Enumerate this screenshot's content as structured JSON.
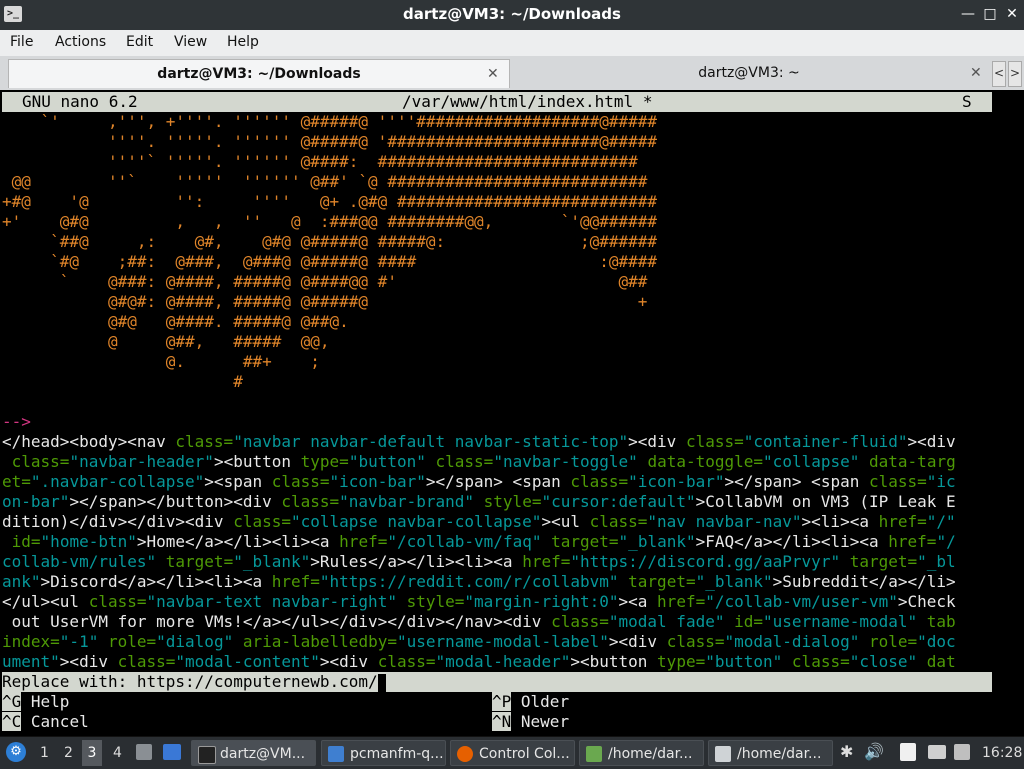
{
  "window": {
    "title": "dartz@VM3: ~/Downloads",
    "minimize": "—",
    "maximize": "□",
    "close": "✕"
  },
  "menu": [
    "File",
    "Actions",
    "Edit",
    "View",
    "Help"
  ],
  "tabs": [
    {
      "label": "dartz@VM3: ~/Downloads",
      "active": true
    },
    {
      "label": "dartz@VM3: ~",
      "active": false
    }
  ],
  "tab_nav": {
    "prev": "<",
    "next": ">"
  },
  "nano": {
    "version": "GNU nano 6.2",
    "file": "/var/www/html/index.html *",
    "flag": "S"
  },
  "ascii_lines": [
    "    `'     ,''', +''''. '''''' @#####@ ''''###################@#####",
    "           ''''. '''''. '''''' @#####@ '######################@#####",
    "           ''''` '''''. '''''' @####:  ###########################",
    " @@        ''`    '''''  '''''' @##' `@ ###########################",
    "+#@    '@         '':     ''''   @+ .@#@ ###########################",
    "+'    @#@         ,   ,  ''   @  :###@@ ########@@,       `'@@######",
    "     `##@     ,:    @#,    @#@ @#####@ #####@:              ;@######",
    "     `#@    ;##:  @###,  @###@ @#####@ ####                   :@####",
    "      `    @###: @####, #####@ @####@@ #'                       @##",
    "           @#@#: @####, #####@ @#####@                            +",
    "           @#@   @####. #####@ @##@.",
    "           @     @##,   #####  @@,",
    "                 @.      ##+    ;",
    "                        #"
  ],
  "comment_end": "-->",
  "code_lines": [
    [
      [
        "w",
        "</head><body><nav "
      ],
      [
        "g",
        "class="
      ],
      [
        "c",
        "\"navbar navbar-default navbar-static-top\""
      ],
      [
        "w",
        "><div "
      ],
      [
        "g",
        "class="
      ],
      [
        "c",
        "\"container-fluid\""
      ],
      [
        "w",
        "><div"
      ]
    ],
    [
      [
        "w",
        " "
      ],
      [
        "g",
        "class="
      ],
      [
        "c",
        "\"navbar-header\""
      ],
      [
        "w",
        "><button "
      ],
      [
        "g",
        "type="
      ],
      [
        "c",
        "\"button\""
      ],
      [
        "w",
        " "
      ],
      [
        "g",
        "class="
      ],
      [
        "c",
        "\"navbar-toggle\""
      ],
      [
        "w",
        " "
      ],
      [
        "g",
        "data-toggle="
      ],
      [
        "c",
        "\"collapse\""
      ],
      [
        "w",
        " "
      ],
      [
        "g",
        "data-targ"
      ]
    ],
    [
      [
        "g",
        "et="
      ],
      [
        "c",
        "\".navbar-collapse\""
      ],
      [
        "w",
        "><span "
      ],
      [
        "g",
        "class="
      ],
      [
        "c",
        "\"icon-bar\""
      ],
      [
        "w",
        "></span> <span "
      ],
      [
        "g",
        "class="
      ],
      [
        "c",
        "\"icon-bar\""
      ],
      [
        "w",
        "></span> <span "
      ],
      [
        "g",
        "class="
      ],
      [
        "c",
        "\"ic"
      ]
    ],
    [
      [
        "c",
        "on-bar\""
      ],
      [
        "w",
        "></span></button><div "
      ],
      [
        "g",
        "class="
      ],
      [
        "c",
        "\"navbar-brand\""
      ],
      [
        "w",
        " "
      ],
      [
        "g",
        "style="
      ],
      [
        "c",
        "\"cursor:default\""
      ],
      [
        "w",
        ">CollabVM on VM3 (IP Leak E"
      ]
    ],
    [
      [
        "w",
        "dition)</div></div><div "
      ],
      [
        "g",
        "class="
      ],
      [
        "c",
        "\"collapse navbar-collapse\""
      ],
      [
        "w",
        "><ul "
      ],
      [
        "g",
        "class="
      ],
      [
        "c",
        "\"nav navbar-nav\""
      ],
      [
        "w",
        "><li><a "
      ],
      [
        "g",
        "href="
      ],
      [
        "c",
        "\"/\""
      ]
    ],
    [
      [
        "w",
        " "
      ],
      [
        "g",
        "id="
      ],
      [
        "c",
        "\"home-btn\""
      ],
      [
        "w",
        ">Home</a></li><li><a "
      ],
      [
        "g",
        "href="
      ],
      [
        "c",
        "\"/collab-vm/faq\""
      ],
      [
        "w",
        " "
      ],
      [
        "g",
        "target="
      ],
      [
        "c",
        "\"_blank\""
      ],
      [
        "w",
        ">FAQ</a></li><li><a "
      ],
      [
        "g",
        "href="
      ],
      [
        "c",
        "\"/"
      ]
    ],
    [
      [
        "c",
        "collab-vm/rules\""
      ],
      [
        "w",
        " "
      ],
      [
        "g",
        "target="
      ],
      [
        "c",
        "\"_blank\""
      ],
      [
        "w",
        ">Rules</a></li><li><a "
      ],
      [
        "g",
        "href="
      ],
      [
        "c",
        "\"https://discord.gg/aaPrvyr\""
      ],
      [
        "w",
        " "
      ],
      [
        "g",
        "target="
      ],
      [
        "c",
        "\"_bl"
      ]
    ],
    [
      [
        "c",
        "ank\""
      ],
      [
        "w",
        ">Discord</a></li><li><a "
      ],
      [
        "g",
        "href="
      ],
      [
        "c",
        "\"https://reddit.com/r/collabvm\""
      ],
      [
        "w",
        " "
      ],
      [
        "g",
        "target="
      ],
      [
        "c",
        "\"_blank\""
      ],
      [
        "w",
        ">Subreddit</a></li>"
      ]
    ],
    [
      [
        "w",
        "</ul><ul "
      ],
      [
        "g",
        "class="
      ],
      [
        "c",
        "\"navbar-text navbar-right\""
      ],
      [
        "w",
        " "
      ],
      [
        "g",
        "style="
      ],
      [
        "c",
        "\"margin-right:0\""
      ],
      [
        "w",
        "><a "
      ],
      [
        "g",
        "href="
      ],
      [
        "c",
        "\"/collab-vm/user-vm\""
      ],
      [
        "w",
        ">Check"
      ]
    ],
    [
      [
        "w",
        " out UserVM for more VMs!</a></ul></div></div></nav><div "
      ],
      [
        "g",
        "class="
      ],
      [
        "c",
        "\"modal fade\""
      ],
      [
        "w",
        " "
      ],
      [
        "g",
        "id="
      ],
      [
        "c",
        "\"username-modal\""
      ],
      [
        "w",
        " "
      ],
      [
        "g",
        "tab"
      ]
    ],
    [
      [
        "g",
        "index="
      ],
      [
        "c",
        "\"-1\""
      ],
      [
        "w",
        " "
      ],
      [
        "g",
        "role="
      ],
      [
        "c",
        "\"dialog\""
      ],
      [
        "w",
        " "
      ],
      [
        "g",
        "aria-labelledby="
      ],
      [
        "c",
        "\"username-modal-label\""
      ],
      [
        "w",
        "><div "
      ],
      [
        "g",
        "class="
      ],
      [
        "c",
        "\"modal-dialog\""
      ],
      [
        "w",
        " "
      ],
      [
        "g",
        "role="
      ],
      [
        "c",
        "\"doc"
      ]
    ],
    [
      [
        "c",
        "ument\""
      ],
      [
        "w",
        "><div "
      ],
      [
        "g",
        "class="
      ],
      [
        "c",
        "\"modal-content\""
      ],
      [
        "w",
        "><div "
      ],
      [
        "g",
        "class="
      ],
      [
        "c",
        "\"modal-header\""
      ],
      [
        "w",
        "><button "
      ],
      [
        "g",
        "type="
      ],
      [
        "c",
        "\"button\""
      ],
      [
        "w",
        " "
      ],
      [
        "g",
        "class="
      ],
      [
        "c",
        "\"close\""
      ],
      [
        "w",
        " "
      ],
      [
        "g",
        "dat"
      ]
    ]
  ],
  "prompt": "Replace with: https://computernewb.com/",
  "shortcuts": [
    {
      "key": "^G",
      "label": "Help"
    },
    {
      "key": "^P",
      "label": "Older"
    },
    {
      "key": "^C",
      "label": "Cancel"
    },
    {
      "key": "^N",
      "label": "Newer"
    }
  ],
  "taskbar": {
    "workspaces": [
      "1",
      "2",
      "3",
      "4"
    ],
    "active_workspace": "3",
    "tasks": [
      "dartz@VM...",
      "pcmanfm-q...",
      "Control Col...",
      "/home/dar...",
      "/home/dar..."
    ],
    "clock": "16:28"
  },
  "colors": {
    "ascii": "#e0852a",
    "attr": "#4e9a06",
    "string": "#06989a",
    "comment": "#d33682"
  }
}
